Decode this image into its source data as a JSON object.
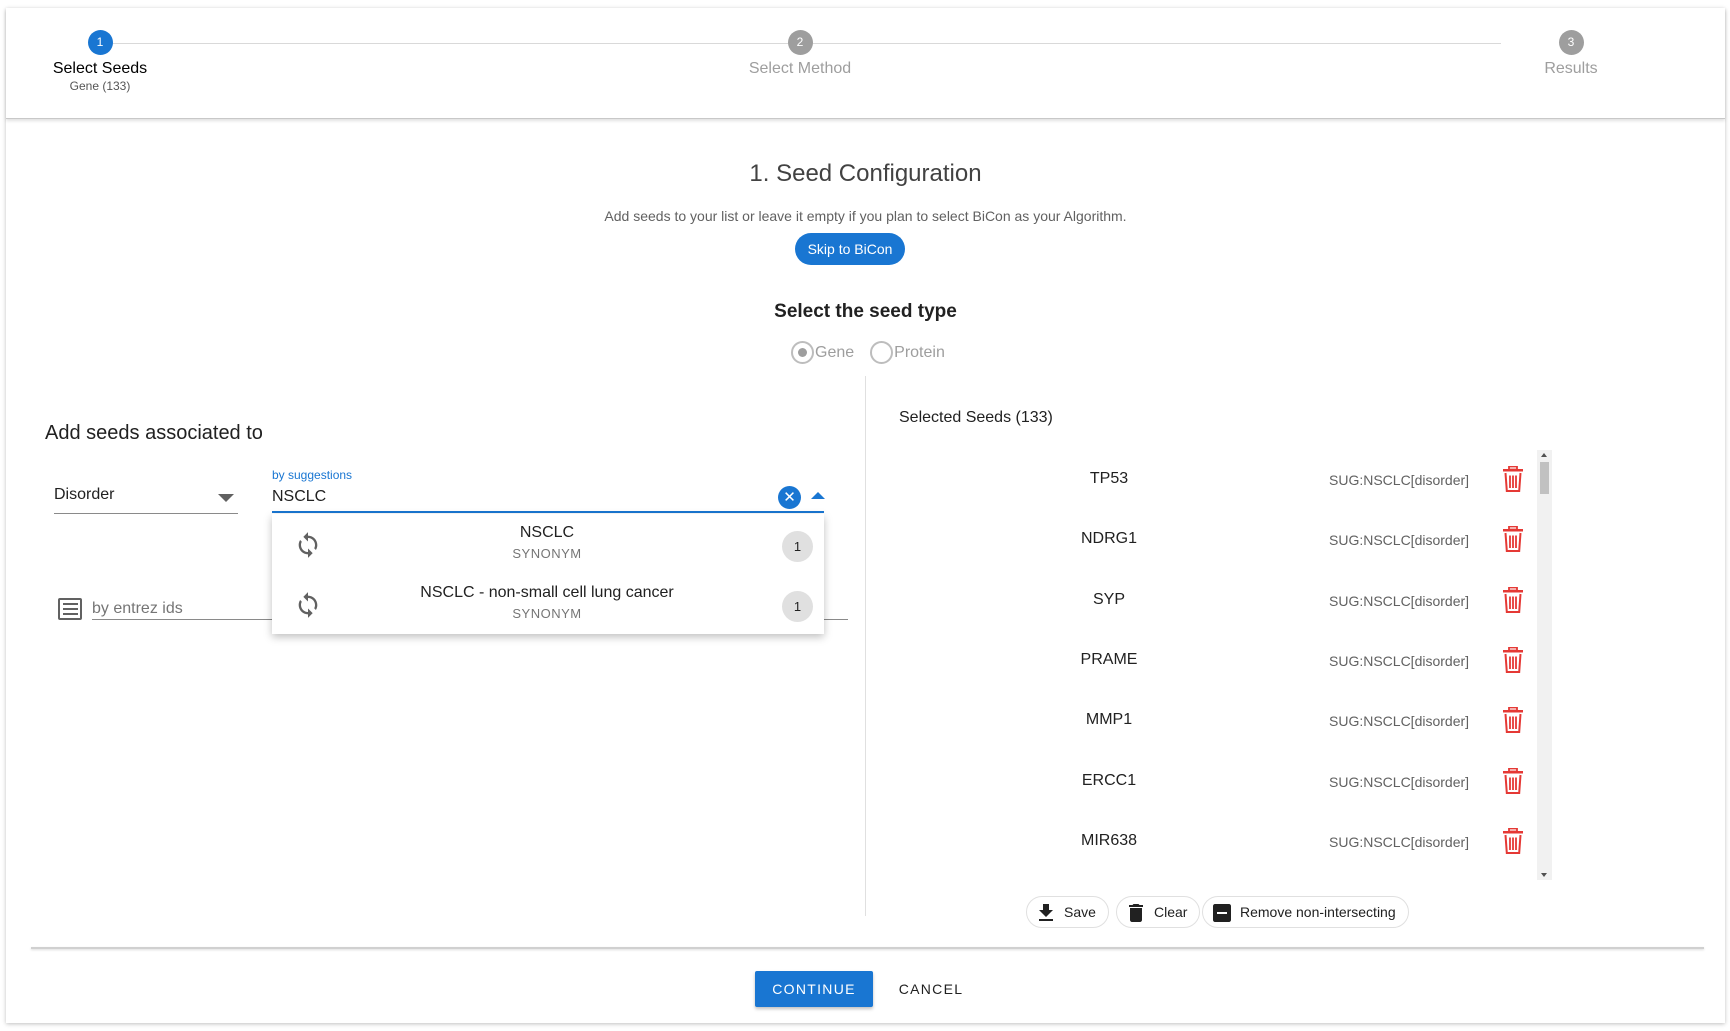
{
  "stepper": {
    "steps": [
      {
        "num": "1",
        "title": "Select Seeds",
        "sub": "Gene (133)",
        "state": "active"
      },
      {
        "num": "2",
        "title": "Select Method",
        "sub": "",
        "state": "inactive"
      },
      {
        "num": "3",
        "title": "Results",
        "sub": "",
        "state": "inactive"
      }
    ]
  },
  "header": {
    "title": "1. Seed Configuration",
    "subtitle": "Add seeds to your list or leave it empty if you plan to select BiCon as your Algorithm.",
    "skip_label": "Skip to BiCon"
  },
  "seed_type": {
    "heading": "Select the seed type",
    "options": [
      {
        "label": "Gene",
        "checked": true
      },
      {
        "label": "Protein",
        "checked": false
      }
    ]
  },
  "left": {
    "heading": "Add seeds associated to",
    "association_select": "Disorder",
    "suggestions_label": "by suggestions",
    "suggestions_value": "NSCLC",
    "clear_symbol": "✕",
    "entrez_placeholder": "by entrez ids",
    "dropdown": [
      {
        "main": "NSCLC",
        "sub": "SYNONYM",
        "count": "1",
        "icon": "refresh-icon"
      },
      {
        "main": "NSCLC - non-small cell lung cancer",
        "sub": "SYNONYM",
        "count": "1",
        "icon": "refresh-icon"
      }
    ]
  },
  "right": {
    "heading": "Selected Seeds (133)",
    "seeds": [
      {
        "name": "TP53",
        "source": "SUG:NSCLC[disorder]"
      },
      {
        "name": "NDRG1",
        "source": "SUG:NSCLC[disorder]"
      },
      {
        "name": "SYP",
        "source": "SUG:NSCLC[disorder]"
      },
      {
        "name": "PRAME",
        "source": "SUG:NSCLC[disorder]"
      },
      {
        "name": "MMP1",
        "source": "SUG:NSCLC[disorder]"
      },
      {
        "name": "ERCC1",
        "source": "SUG:NSCLC[disorder]"
      },
      {
        "name": "MIR638",
        "source": "SUG:NSCLC[disorder]"
      }
    ],
    "actions": {
      "save": "Save",
      "clear": "Clear",
      "remove": "Remove non-intersecting"
    }
  },
  "footer": {
    "continue": "CONTINUE",
    "cancel": "CANCEL"
  },
  "colors": {
    "primary": "#1976d2",
    "danger": "#e53935",
    "muted": "#9e9e9e"
  }
}
